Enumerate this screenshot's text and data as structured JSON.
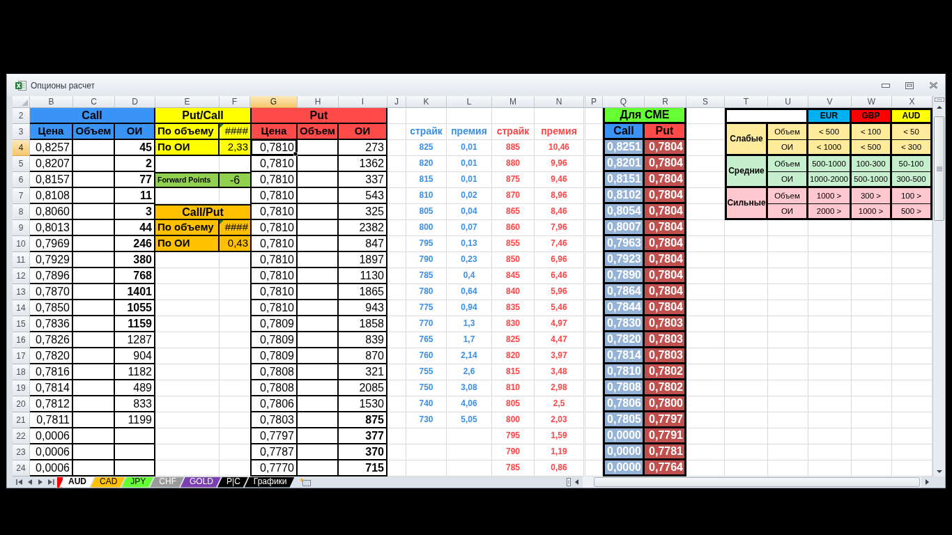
{
  "window": {
    "title": "Опционы расчет"
  },
  "column_headers": [
    {
      "label": "B",
      "selected": false
    },
    {
      "label": "C",
      "selected": false
    },
    {
      "label": "D",
      "selected": false
    },
    {
      "label": "E",
      "selected": false
    },
    {
      "label": "F",
      "selected": false
    },
    {
      "label": "G",
      "selected": true
    },
    {
      "label": "H",
      "selected": false
    },
    {
      "label": "I",
      "selected": false
    },
    {
      "label": "J",
      "selected": false
    },
    {
      "label": "K",
      "selected": false
    },
    {
      "label": "L",
      "selected": false
    },
    {
      "label": "M",
      "selected": false
    },
    {
      "label": "N",
      "selected": false
    },
    {
      "label": "P",
      "selected": false
    },
    {
      "label": "Q",
      "selected": false
    },
    {
      "label": "R",
      "selected": false
    },
    {
      "label": "S",
      "selected": false
    },
    {
      "label": "T",
      "selected": false
    },
    {
      "label": "U",
      "selected": false
    },
    {
      "label": "V",
      "selected": false
    },
    {
      "label": "W",
      "selected": false
    },
    {
      "label": "X",
      "selected": false
    }
  ],
  "row_headers": [
    {
      "label": "2",
      "selected": false
    },
    {
      "label": "3",
      "selected": false
    },
    {
      "label": "4",
      "selected": true
    },
    {
      "label": "5",
      "selected": false
    },
    {
      "label": "6",
      "selected": false
    },
    {
      "label": "7",
      "selected": false
    },
    {
      "label": "8",
      "selected": false
    },
    {
      "label": "9",
      "selected": false
    },
    {
      "label": "10",
      "selected": false
    },
    {
      "label": "11",
      "selected": false
    },
    {
      "label": "12",
      "selected": false
    },
    {
      "label": "13",
      "selected": false
    },
    {
      "label": "14",
      "selected": false
    },
    {
      "label": "15",
      "selected": false
    },
    {
      "label": "16",
      "selected": false
    },
    {
      "label": "17",
      "selected": false
    },
    {
      "label": "18",
      "selected": false
    },
    {
      "label": "19",
      "selected": false
    },
    {
      "label": "20",
      "selected": false
    },
    {
      "label": "21",
      "selected": false
    },
    {
      "label": "22",
      "selected": false
    },
    {
      "label": "23",
      "selected": false
    },
    {
      "label": "24",
      "selected": false
    }
  ],
  "call_table": {
    "title": "Call",
    "columns": [
      "Цена",
      "Объем",
      "ОИ"
    ],
    "rows": [
      {
        "price": "0,8257",
        "oi": "45",
        "emphasized": true
      },
      {
        "price": "0,8207",
        "oi": "2",
        "emphasized": true
      },
      {
        "price": "0,8157",
        "oi": "77",
        "emphasized": true
      },
      {
        "price": "0,8108",
        "oi": "11",
        "emphasized": true
      },
      {
        "price": "0,8060",
        "oi": "3",
        "emphasized": true
      },
      {
        "price": "0,8013",
        "oi": "44",
        "emphasized": true
      },
      {
        "price": "0,7969",
        "oi": "246",
        "emphasized": true
      },
      {
        "price": "0,7929",
        "oi": "380",
        "emphasized": true
      },
      {
        "price": "0,7896",
        "oi": "768",
        "emphasized": true
      },
      {
        "price": "0,7870",
        "oi": "1401",
        "emphasized": true
      },
      {
        "price": "0,7850",
        "oi": "1055",
        "emphasized": true
      },
      {
        "price": "0,7836",
        "oi": "1159",
        "emphasized": true
      },
      {
        "price": "0,7826",
        "oi": "1287",
        "emphasized": false
      },
      {
        "price": "0,7820",
        "oi": "904",
        "emphasized": false
      },
      {
        "price": "0,7816",
        "oi": "1182",
        "emphasized": false
      },
      {
        "price": "0,7814",
        "oi": "489",
        "emphasized": false
      },
      {
        "price": "0,7812",
        "oi": "833",
        "emphasized": false
      },
      {
        "price": "0,7811",
        "oi": "1199",
        "emphasized": false
      },
      {
        "price": "0,0006"
      },
      {
        "price": "0,0006"
      },
      {
        "price": "0,0006"
      }
    ]
  },
  "put_call": {
    "title": "Put/Call",
    "rows": [
      {
        "label": "По объему",
        "value": "####",
        "flagged": true
      },
      {
        "label": "По ОИ",
        "value": "2,33",
        "flagged": false
      }
    ]
  },
  "forward_points": {
    "label": "Forward Points",
    "value": "-6"
  },
  "call_put": {
    "title": "Call/Put",
    "rows": [
      {
        "label": "По объему",
        "value": "####",
        "flagged": true
      },
      {
        "label": "По ОИ",
        "value": "0,43",
        "flagged": false
      }
    ]
  },
  "put_table": {
    "title": "Put",
    "columns": [
      "Цена",
      "Объем",
      "ОИ"
    ],
    "rows": [
      {
        "price": "0,7810",
        "oi": "273",
        "emphasized": false
      },
      {
        "price": "0,7810",
        "oi": "1362",
        "emphasized": false
      },
      {
        "price": "0,7810",
        "oi": "337",
        "emphasized": false
      },
      {
        "price": "0,7810",
        "oi": "543",
        "emphasized": false
      },
      {
        "price": "0,7810",
        "oi": "325",
        "emphasized": false
      },
      {
        "price": "0,7810",
        "oi": "2382",
        "emphasized": false
      },
      {
        "price": "0,7810",
        "oi": "847",
        "emphasized": false
      },
      {
        "price": "0,7810",
        "oi": "1897",
        "emphasized": false
      },
      {
        "price": "0,7810",
        "oi": "1130",
        "emphasized": false
      },
      {
        "price": "0,7810",
        "oi": "1865",
        "emphasized": false
      },
      {
        "price": "0,7810",
        "oi": "943",
        "emphasized": false
      },
      {
        "price": "0,7809",
        "oi": "1858",
        "emphasized": false
      },
      {
        "price": "0,7809",
        "oi": "839",
        "emphasized": false
      },
      {
        "price": "0,7809",
        "oi": "870",
        "emphasized": false
      },
      {
        "price": "0,7808",
        "oi": "321",
        "emphasized": false
      },
      {
        "price": "0,7808",
        "oi": "2085",
        "emphasized": false
      },
      {
        "price": "0,7806",
        "oi": "1530",
        "emphasized": false
      },
      {
        "price": "0,7803",
        "oi": "875",
        "emphasized": true
      },
      {
        "price": "0,7797",
        "oi": "377",
        "emphasized": true
      },
      {
        "price": "0,7787",
        "oi": "370",
        "emphasized": true
      },
      {
        "price": "0,7770",
        "oi": "715",
        "emphasized": true
      }
    ]
  },
  "call_strikes": {
    "columns": [
      "страйк",
      "премия"
    ],
    "rows": [
      {
        "strike": "825",
        "premium": "0,01"
      },
      {
        "strike": "820",
        "premium": "0,01"
      },
      {
        "strike": "815",
        "premium": "0,01"
      },
      {
        "strike": "810",
        "premium": "0,02"
      },
      {
        "strike": "805",
        "premium": "0,04"
      },
      {
        "strike": "800",
        "premium": "0,07"
      },
      {
        "strike": "795",
        "premium": "0,13"
      },
      {
        "strike": "790",
        "premium": "0,23"
      },
      {
        "strike": "785",
        "premium": "0,4"
      },
      {
        "strike": "780",
        "premium": "0,64"
      },
      {
        "strike": "775",
        "premium": "0,94"
      },
      {
        "strike": "770",
        "premium": "1,3"
      },
      {
        "strike": "765",
        "premium": "1,7"
      },
      {
        "strike": "760",
        "premium": "2,14"
      },
      {
        "strike": "755",
        "premium": "2,6"
      },
      {
        "strike": "750",
        "premium": "3,08"
      },
      {
        "strike": "740",
        "premium": "4,06"
      },
      {
        "strike": "730",
        "premium": "5,05"
      }
    ]
  },
  "put_strikes": {
    "columns": [
      "страйк",
      "премия"
    ],
    "rows": [
      {
        "strike": "885",
        "premium": "10,46"
      },
      {
        "strike": "880",
        "premium": "9,96"
      },
      {
        "strike": "875",
        "premium": "9,46"
      },
      {
        "strike": "870",
        "premium": "8,96"
      },
      {
        "strike": "865",
        "premium": "8,46"
      },
      {
        "strike": "860",
        "premium": "7,96"
      },
      {
        "strike": "855",
        "premium": "7,46"
      },
      {
        "strike": "850",
        "premium": "6,96"
      },
      {
        "strike": "845",
        "premium": "6,46"
      },
      {
        "strike": "840",
        "premium": "5,96"
      },
      {
        "strike": "835",
        "premium": "5,46"
      },
      {
        "strike": "830",
        "premium": "4,97"
      },
      {
        "strike": "825",
        "premium": "4,47"
      },
      {
        "strike": "820",
        "premium": "3,97"
      },
      {
        "strike": "815",
        "premium": "3,48"
      },
      {
        "strike": "810",
        "premium": "2,98"
      },
      {
        "strike": "805",
        "premium": "2,5"
      },
      {
        "strike": "800",
        "premium": "2,03"
      },
      {
        "strike": "795",
        "premium": "1,59"
      },
      {
        "strike": "790",
        "premium": "1,19"
      },
      {
        "strike": "785",
        "premium": "0,86"
      }
    ]
  },
  "cme": {
    "title": "Для CME",
    "columns": [
      "Call",
      "Put"
    ],
    "rows": [
      {
        "call": "0,8251",
        "put": "0,7804"
      },
      {
        "call": "0,8201",
        "put": "0,7804"
      },
      {
        "call": "0,8151",
        "put": "0,7804"
      },
      {
        "call": "0,8102",
        "put": "0,7804"
      },
      {
        "call": "0,8054",
        "put": "0,7804"
      },
      {
        "call": "0,8007",
        "put": "0,7804"
      },
      {
        "call": "0,7963",
        "put": "0,7804"
      },
      {
        "call": "0,7923",
        "put": "0,7804"
      },
      {
        "call": "0,7890",
        "put": "0,7804"
      },
      {
        "call": "0,7864",
        "put": "0,7804"
      },
      {
        "call": "0,7844",
        "put": "0,7804"
      },
      {
        "call": "0,7830",
        "put": "0,7803"
      },
      {
        "call": "0,7820",
        "put": "0,7803"
      },
      {
        "call": "0,7814",
        "put": "0,7803"
      },
      {
        "call": "0,7810",
        "put": "0,7802"
      },
      {
        "call": "0,7808",
        "put": "0,7802"
      },
      {
        "call": "0,7806",
        "put": "0,7800"
      },
      {
        "call": "0,7805",
        "put": "0,7797"
      },
      {
        "call": "0,0000",
        "put": "0,7791"
      },
      {
        "call": "0,0000",
        "put": "0,7781"
      },
      {
        "call": "0,0000",
        "put": "0,7764"
      }
    ]
  },
  "strength_table": {
    "currencies": [
      {
        "label": "EUR",
        "color": "#00b0f0"
      },
      {
        "label": "GBP",
        "color": "#ff0000"
      },
      {
        "label": "AUD",
        "color": "#ffff00"
      }
    ],
    "groups": [
      {
        "label": "Слабые",
        "color": "#ffeb9c",
        "rows": [
          {
            "label": "Объем",
            "values": [
              "< 500",
              "< 100",
              "< 50"
            ]
          },
          {
            "label": "ОИ",
            "values": [
              "< 1000",
              "< 500",
              "< 300"
            ]
          }
        ]
      },
      {
        "label": "Средние",
        "color": "#c6efce",
        "rows": [
          {
            "label": "Объем",
            "values": [
              "500-1000",
              "100-300",
              "50-100"
            ]
          },
          {
            "label": "ОИ",
            "values": [
              "1000-2000",
              "500-1000",
              "300-500"
            ]
          }
        ]
      },
      {
        "label": "Сильные",
        "color": "#ffc7ce",
        "rows": [
          {
            "label": "Объем",
            "values": [
              "1000 >",
              "300 >",
              "100 >"
            ]
          },
          {
            "label": "ОИ",
            "values": [
              "2000 >",
              "1000 >",
              "500 >"
            ]
          }
        ]
      }
    ]
  },
  "sheet_tabs": [
    {
      "kind": "partial",
      "color": "#ff0000",
      "selected": false
    },
    {
      "kind": "tab",
      "label": "AUD",
      "selected": true
    },
    {
      "kind": "tab",
      "label": "CAD",
      "color": "#ffc000",
      "selected": false
    },
    {
      "kind": "tab",
      "label": "JPY",
      "color": "#66ff33",
      "selected": false
    },
    {
      "kind": "tab",
      "label": "CHF",
      "color": "#9a9a9a",
      "selected": false
    },
    {
      "kind": "tab",
      "label": "GOLD",
      "color": "#7b3fb0",
      "selected": false
    },
    {
      "kind": "tab",
      "label": "P|C",
      "color": "#000000",
      "selected": false
    },
    {
      "kind": "tab",
      "label": "Графики",
      "color": "#000000",
      "selected": false
    }
  ]
}
